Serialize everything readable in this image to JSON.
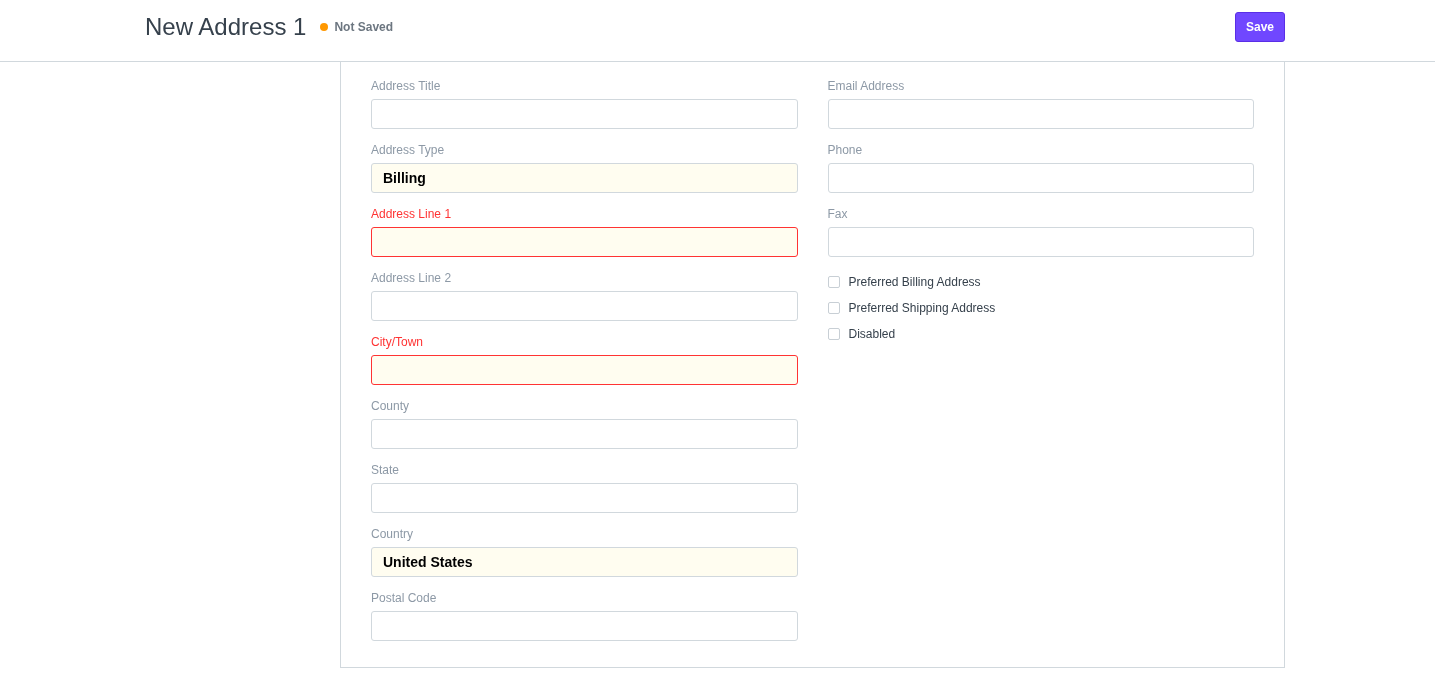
{
  "header": {
    "title": "New Address 1",
    "status": {
      "text": "Not Saved",
      "color": "#ff9800"
    },
    "save_button": "Save"
  },
  "left_fields": [
    {
      "label": "Address Title",
      "mandatory": false,
      "error": false
    },
    {
      "label": "Address Type",
      "value": "Billing",
      "mandatory": true,
      "error": false
    },
    {
      "label": "Address Line 1",
      "mandatory": true,
      "error": true
    },
    {
      "label": "Address Line 2",
      "mandatory": false,
      "error": false
    },
    {
      "label": "City/Town",
      "mandatory": true,
      "error": true
    },
    {
      "label": "County",
      "mandatory": false,
      "error": false
    },
    {
      "label": "State",
      "mandatory": false,
      "error": false
    },
    {
      "label": "Country",
      "value": "United States",
      "mandatory": true,
      "error": false
    },
    {
      "label": "Postal Code",
      "mandatory": false,
      "error": false
    }
  ],
  "right_fields": [
    {
      "label": "Email Address",
      "mandatory": false,
      "error": false
    },
    {
      "label": "Phone",
      "mandatory": false,
      "error": false
    },
    {
      "label": "Fax",
      "mandatory": false,
      "error": false
    }
  ],
  "checkboxes": [
    {
      "label": "Preferred Billing Address",
      "checked": false
    },
    {
      "label": "Preferred Shipping Address",
      "checked": false
    },
    {
      "label": "Disabled",
      "checked": false
    }
  ]
}
